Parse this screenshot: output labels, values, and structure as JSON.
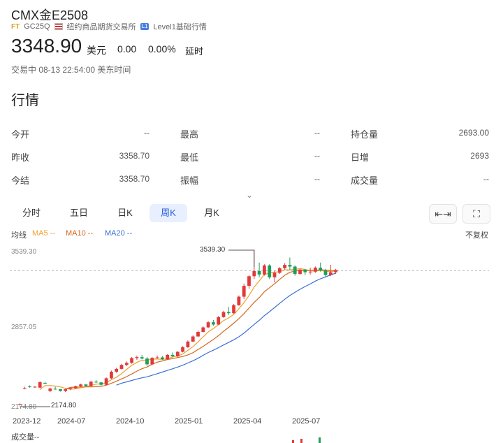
{
  "header": {
    "title": "CMX金E2508",
    "ft_badge": "FT",
    "code": "GC25Q",
    "exchange": "纽约商品期货交易所",
    "level_badge": "L1",
    "level": "Level1基础行情",
    "price": "3348.90",
    "unit": "美元",
    "change": "0.00",
    "change_pct": "0.00%",
    "delay": "延时",
    "status_time": "交易中 08-13 22:54:00 美东时间"
  },
  "section_title": "行情",
  "quote": {
    "open_label": "今开",
    "open": "--",
    "prev_close_label": "昨收",
    "prev_close": "3358.70",
    "settle_label": "今结",
    "settle": "3358.70",
    "high_label": "最高",
    "high": "--",
    "low_label": "最低",
    "low": "--",
    "amplitude_label": "振幅",
    "amplitude": "--",
    "oi_label": "持仓量",
    "oi": "2693.00",
    "daily_inc_label": "日增",
    "daily_inc": "2693",
    "volume_label": "成交量",
    "volume": "--"
  },
  "tabs": [
    "分时",
    "五日",
    "日K",
    "周K",
    "月K"
  ],
  "active_tab": "周K",
  "toolbar": {
    "expand_icon": "fit-width-icon",
    "fullscreen_icon": "fullscreen-icon",
    "adjust": "不复权"
  },
  "legend": {
    "label": "均线",
    "ma5": "MA5 --",
    "ma10": "MA10 --",
    "ma20": "MA20 --"
  },
  "colors": {
    "up": "#e03a3a",
    "down": "#1f9e5a",
    "ma5": "#f0a030",
    "ma10": "#d2691e",
    "ma20": "#3a6fd8",
    "accent": "#2b5fd9"
  },
  "volume_label": "成交量--",
  "chart_data": {
    "type": "candlestick",
    "period": "weekly",
    "y_axis_labels": [
      "3539.30",
      "2857.05",
      "2174.80"
    ],
    "max_marker": "3539.30",
    "min_marker": "2174.80",
    "ylim": [
      2174.8,
      3539.3
    ],
    "x_labels": [
      "2023-12",
      "2024-07",
      "2024-10",
      "2025-01",
      "2025-04",
      "2025-07"
    ],
    "reference_price": 3358.7,
    "series": [
      {
        "name": "K",
        "values": [
          [
            2183,
            2190,
            2175,
            2185
          ],
          [
            2320,
            2338,
            2315,
            2325
          ],
          [
            2340,
            2350,
            2330,
            2335
          ],
          [
            2335,
            2342,
            2328,
            2338
          ],
          [
            2330,
            2385,
            2325,
            2378
          ],
          [
            2372,
            2380,
            2362,
            2365
          ],
          [
            2300,
            2330,
            2290,
            2322
          ],
          [
            2320,
            2338,
            2312,
            2316
          ],
          [
            2316,
            2318,
            2295,
            2300
          ],
          [
            2300,
            2320,
            2290,
            2316
          ],
          [
            2316,
            2330,
            2308,
            2325
          ],
          [
            2325,
            2348,
            2318,
            2342
          ],
          [
            2342,
            2365,
            2335,
            2358
          ],
          [
            2358,
            2362,
            2340,
            2345
          ],
          [
            2345,
            2390,
            2340,
            2382
          ],
          [
            2382,
            2395,
            2370,
            2376
          ],
          [
            2376,
            2380,
            2348,
            2355
          ],
          [
            2355,
            2420,
            2350,
            2412
          ],
          [
            2412,
            2480,
            2405,
            2470
          ],
          [
            2470,
            2505,
            2460,
            2495
          ],
          [
            2495,
            2540,
            2490,
            2530
          ],
          [
            2530,
            2560,
            2518,
            2548
          ],
          [
            2548,
            2600,
            2540,
            2590
          ],
          [
            2590,
            2612,
            2575,
            2598
          ],
          [
            2598,
            2618,
            2578,
            2586
          ],
          [
            2586,
            2600,
            2520,
            2535
          ],
          [
            2535,
            2598,
            2528,
            2592
          ],
          [
            2592,
            2612,
            2585,
            2596
          ],
          [
            2596,
            2608,
            2575,
            2580
          ],
          [
            2580,
            2625,
            2575,
            2618
          ],
          [
            2618,
            2640,
            2598,
            2605
          ],
          [
            2605,
            2650,
            2600,
            2645
          ],
          [
            2645,
            2695,
            2640,
            2685
          ],
          [
            2685,
            2745,
            2680,
            2735
          ],
          [
            2735,
            2790,
            2730,
            2780
          ],
          [
            2780,
            2832,
            2775,
            2820
          ],
          [
            2820,
            2870,
            2815,
            2860
          ],
          [
            2860,
            2915,
            2855,
            2905
          ],
          [
            2905,
            2925,
            2875,
            2885
          ],
          [
            2885,
            2960,
            2880,
            2950
          ],
          [
            2950,
            3005,
            2945,
            2995
          ],
          [
            2995,
            3040,
            2970,
            2985
          ],
          [
            2985,
            3065,
            2980,
            3055
          ],
          [
            3055,
            3140,
            3050,
            3130
          ],
          [
            3130,
            3245,
            3110,
            3225
          ],
          [
            3225,
            3320,
            3200,
            3310
          ],
          [
            3310,
            3539,
            3285,
            3355
          ],
          [
            3355,
            3430,
            3300,
            3325
          ],
          [
            3325,
            3415,
            3315,
            3405
          ],
          [
            3405,
            3415,
            3285,
            3300
          ],
          [
            3300,
            3360,
            3255,
            3340
          ],
          [
            3340,
            3390,
            3330,
            3380
          ],
          [
            3380,
            3425,
            3370,
            3410
          ],
          [
            3410,
            3475,
            3365,
            3395
          ],
          [
            3395,
            3405,
            3315,
            3330
          ],
          [
            3330,
            3375,
            3320,
            3368
          ],
          [
            3368,
            3375,
            3320,
            3345
          ],
          [
            3345,
            3385,
            3325,
            3350
          ],
          [
            3350,
            3395,
            3340,
            3385
          ],
          [
            3385,
            3430,
            3350,
            3360
          ],
          [
            3360,
            3375,
            3305,
            3320
          ],
          [
            3320,
            3410,
            3310,
            3345
          ],
          [
            3345,
            3375,
            3330,
            3365
          ]
        ]
      }
    ]
  }
}
